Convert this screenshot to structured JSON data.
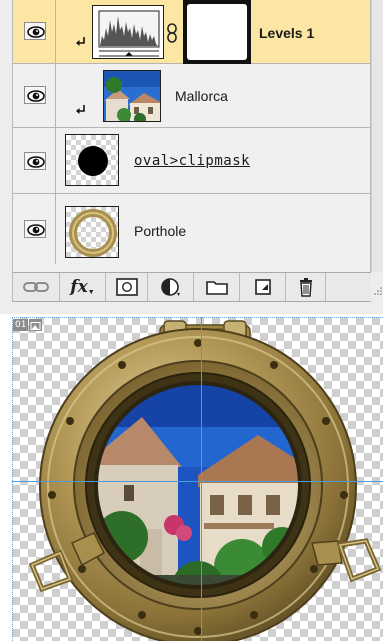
{
  "layers": [
    {
      "name": "Levels 1",
      "kind": "adjustment",
      "selected": true,
      "clipped": true
    },
    {
      "name": "Mallorca",
      "kind": "image",
      "selected": false,
      "clipped": true
    },
    {
      "name": "oval>clipmask",
      "kind": "shape",
      "selected": false,
      "clipped": false
    },
    {
      "name": "Porthole",
      "kind": "image",
      "selected": false,
      "clipped": false
    }
  ],
  "toolbar": {
    "buttons": [
      {
        "name": "link-layers-icon"
      },
      {
        "name": "layer-style-fx-icon",
        "label": "fx"
      },
      {
        "name": "layer-mask-icon"
      },
      {
        "name": "adjustment-layer-icon"
      },
      {
        "name": "new-group-folder-icon"
      },
      {
        "name": "new-layer-icon"
      },
      {
        "name": "trash-icon"
      }
    ]
  },
  "canvas": {
    "slice_number": "01"
  },
  "colors": {
    "selected_row": "#fbe6a3",
    "guide": "#4f9bd9",
    "brass": "#b59a54",
    "sea": "#1f5fc4"
  }
}
